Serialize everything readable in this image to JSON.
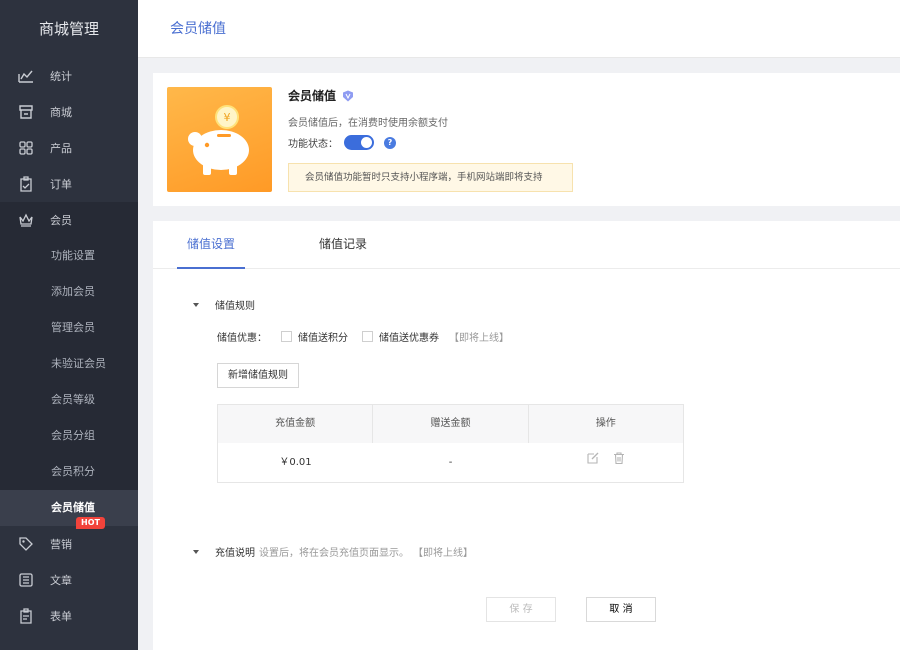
{
  "sidebar": {
    "brand": "商城管理",
    "items": [
      {
        "label": "统计",
        "icon": "chart-line-icon"
      },
      {
        "label": "商城",
        "icon": "store-icon"
      },
      {
        "label": "产品",
        "icon": "grid-icon"
      },
      {
        "label": "订单",
        "icon": "clipboard-icon"
      },
      {
        "label": "会员",
        "icon": "crown-icon"
      }
    ],
    "member_sub": [
      "功能设置",
      "添加会员",
      "管理会员",
      "未验证会员",
      "会员等级",
      "会员分组",
      "会员积分",
      "会员储值"
    ],
    "active_sub": "会员储值",
    "more": [
      {
        "label": "营销",
        "icon": "tag-icon",
        "badge": "HOT"
      },
      {
        "label": "文章",
        "icon": "list-icon"
      },
      {
        "label": "表单",
        "icon": "form-icon"
      }
    ]
  },
  "header": {
    "title": "会员储值"
  },
  "feature": {
    "title": "会员储值",
    "desc": "会员储值后，在消费时使用余额支付",
    "status_label": "功能状态：",
    "enabled": true,
    "help": "?",
    "notice": "会员储值功能暂时只支持小程序端，手机网站端即将支持"
  },
  "tabs": [
    {
      "label": "储值设置",
      "active": true
    },
    {
      "label": "储值记录",
      "active": false
    }
  ],
  "rules": {
    "heading": "储值规则",
    "discount_label": "储值优惠：",
    "options": [
      "储值送积分",
      "储值送优惠券"
    ],
    "coming": "【即将上线】",
    "add_button": "新增储值规则",
    "table": {
      "headers": [
        "充值金额",
        "赠送金额",
        "操作"
      ],
      "rows": [
        {
          "amount": "￥0.01",
          "bonus": "-"
        }
      ]
    }
  },
  "explain": {
    "heading": "充值说明",
    "hint": "设置后，将在会员充值页面显示。",
    "coming": "【即将上线】"
  },
  "footer": {
    "save": "保 存",
    "cancel": "取 消"
  },
  "colors": {
    "accent": "#4a6fd1",
    "sidebar": "#2d323e",
    "hot": "#f2433b",
    "piggy": "#ffa932"
  }
}
